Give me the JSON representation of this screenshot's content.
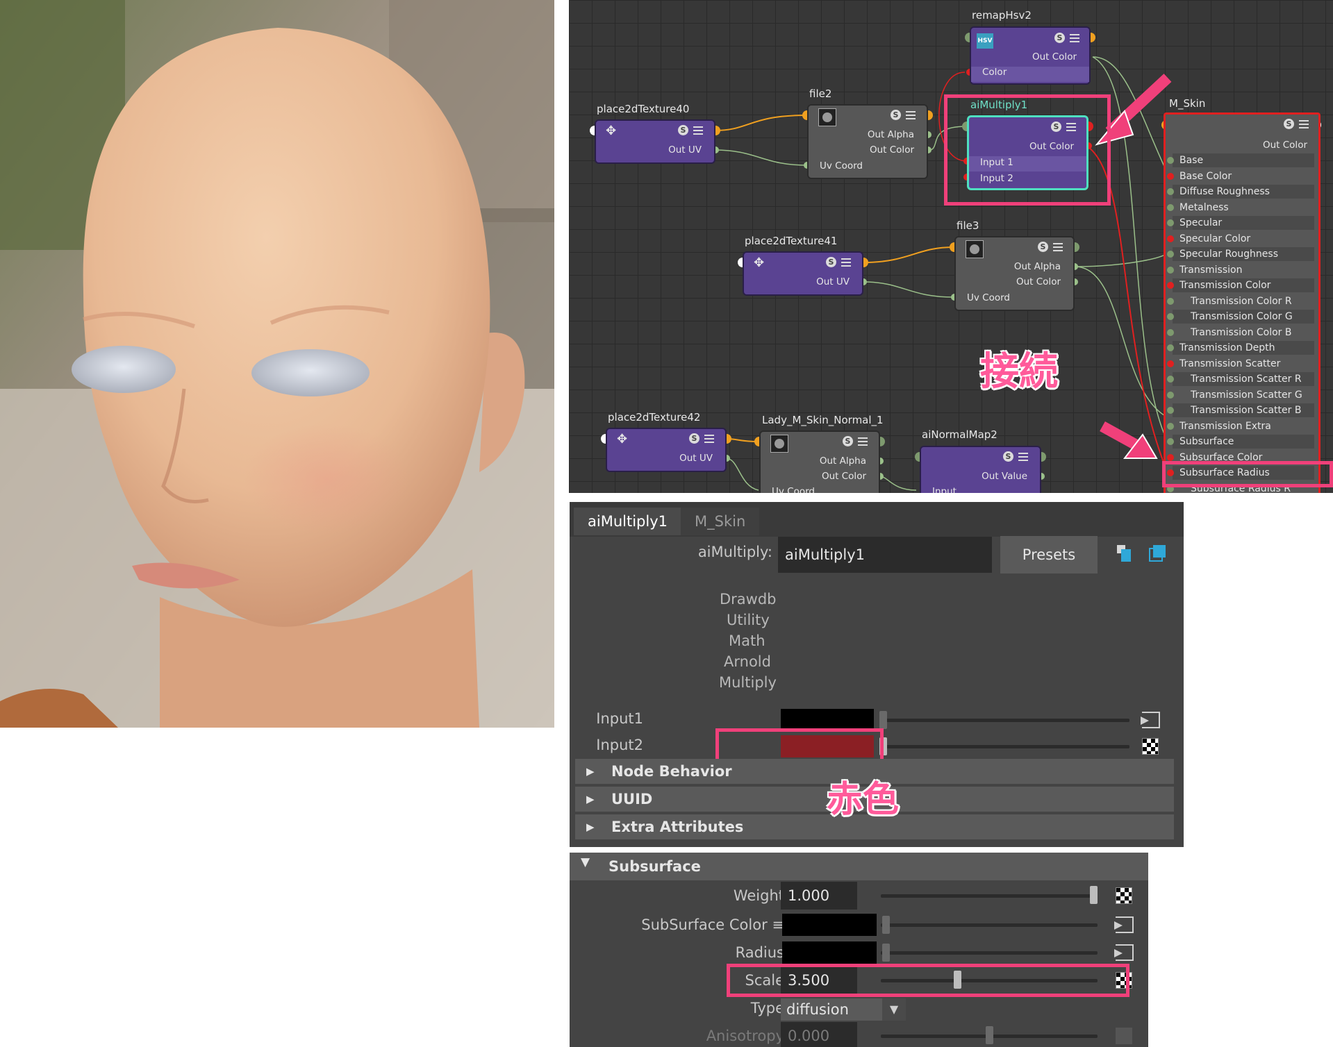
{
  "node_editor": {
    "nodes": {
      "remapHsv2": {
        "title": "remapHsv2",
        "badge": "HSV",
        "ports": [
          "Out Color",
          "Color"
        ]
      },
      "file2": {
        "title": "file2",
        "ports": [
          "Out Alpha",
          "Out Color",
          "Uv Coord"
        ]
      },
      "place2dTexture40": {
        "title": "place2dTexture40",
        "ports": [
          "Out UV"
        ]
      },
      "aiMultiply1": {
        "title": "aiMultiply1",
        "ports": [
          "Out Color",
          "Input 1",
          "Input 2"
        ]
      },
      "place2dTexture41": {
        "title": "place2dTexture41",
        "ports": [
          "Out UV"
        ]
      },
      "file3": {
        "title": "file3",
        "ports": [
          "Out Alpha",
          "Out Color",
          "Uv Coord"
        ]
      },
      "place2dTexture42": {
        "title": "place2dTexture42",
        "ports": [
          "Out UV"
        ]
      },
      "ladyNormal": {
        "title": "Lady_M_Skin_Normal_1",
        "ports": [
          "Out Alpha",
          "Out Color",
          "Uv Coord"
        ]
      },
      "aiNormalMap2": {
        "title": "aiNormalMap2",
        "ports": [
          "Out Value",
          "Input"
        ]
      }
    },
    "m_skin": {
      "title": "M_Skin",
      "out": "Out Color",
      "attrs": [
        "Base",
        "Base Color",
        "Diffuse Roughness",
        "Metalness",
        "Specular",
        "Specular Color",
        "Specular Roughness",
        "Transmission",
        "Transmission Color",
        "Transmission Color R",
        "Transmission Color G",
        "Transmission Color B",
        "Transmission Depth",
        "Transmission Scatter",
        "Transmission Scatter R",
        "Transmission Scatter G",
        "Transmission Scatter B",
        "Transmission Extra Roughness",
        "Subsurface",
        "Subsurface Color",
        "Subsurface Radius",
        "Subsurface Radius R"
      ]
    },
    "s_button": "S",
    "annotation": "接続"
  },
  "attr_editor": {
    "tabs": [
      "aiMultiply1",
      "M_Skin"
    ],
    "name_label": "aiMultiply:",
    "name_value": "aiMultiply1",
    "presets": "Presets",
    "categories": [
      "Drawdb",
      "Utility",
      "Math",
      "Arnold",
      "Multiply"
    ],
    "input1_label": "Input1",
    "input2_label": "Input2",
    "input2_color": "#8b1f24",
    "sections": [
      "Node Behavior",
      "UUID",
      "Extra Attributes"
    ],
    "annotation": "赤色"
  },
  "subsurface": {
    "title": "Subsurface",
    "weight_label": "Weight",
    "weight_value": "1.000",
    "weight_level": 1.0,
    "color_label": "SubSurface Color ≡",
    "radius_label": "Radius",
    "scale_label": "Scale",
    "scale_value": "3.500",
    "scale_level": 0.35,
    "type_label": "Type",
    "type_value": "diffusion",
    "aniso_label": "Anisotropy",
    "aniso_value": "0.000",
    "aniso_level": 0.5
  },
  "colors": {
    "accent_highlight": "#f0407a",
    "node_purple": "#5a4392",
    "selected_outline": "#4fe0c0",
    "shader_outline": "#e02020"
  }
}
